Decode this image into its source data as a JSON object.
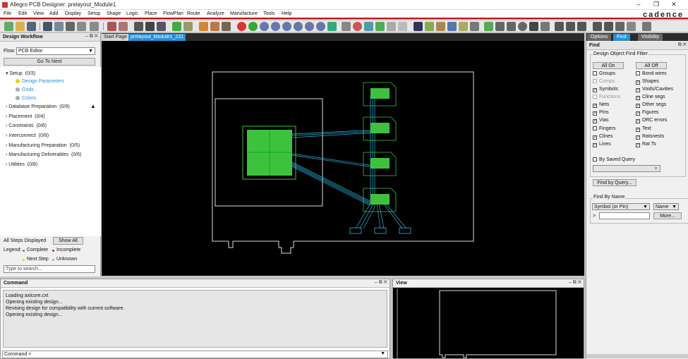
{
  "window": {
    "title": "Allegro PCB Designer: prelayout_Module1"
  },
  "brand": "cadence",
  "menu": [
    "File",
    "Edit",
    "View",
    "Add",
    "Display",
    "Setup",
    "Shape",
    "Logic",
    "Place",
    "FlowPlan",
    "Route",
    "Analyze",
    "Manufacture",
    "Tools",
    "Help"
  ],
  "workflow": {
    "title": "Design Workflow",
    "flow_label": "Flow:",
    "flow_value": "PCB Editor",
    "go_next": "Go To Next",
    "items": [
      {
        "label": "Setup",
        "count": "(0/3)"
      },
      {
        "label": "Design Parameters"
      },
      {
        "label": "Grids"
      },
      {
        "label": "Colors"
      },
      {
        "label": "Database Preparation",
        "count": "(0/9)"
      },
      {
        "label": "Placement",
        "count": "(0/4)"
      },
      {
        "label": "Constraints",
        "count": "(0/6)"
      },
      {
        "label": "Interconnect",
        "count": "(0/8)"
      },
      {
        "label": "Manufacturing Preparation",
        "count": "(0/5)"
      },
      {
        "label": "Manufacturing Deliverables",
        "count": "(0/6)"
      },
      {
        "label": "Utilities",
        "count": "(0/8)"
      }
    ],
    "all_steps": "All Steps Displayed",
    "show_all": "Show All",
    "legend_label": "Legend:",
    "legend": [
      "Complete",
      "Incomplete",
      "Next Step",
      "Unknown"
    ],
    "search_placeholder": "Type to search..."
  },
  "tabs": [
    "Start Page",
    "prelayout_Module1_231"
  ],
  "command": {
    "title": "Command",
    "lines": [
      "Loading axlcore.cxt",
      "Opening existing design...",
      "Revising design for compatibility with current software.",
      "Opening existing design..."
    ],
    "prompt": "Command >"
  },
  "view": {
    "title": "View"
  },
  "right": {
    "tabs": [
      "Options",
      "Find",
      "Visibility"
    ],
    "find_title": "Find",
    "filter_group": "Design Object Find Filter",
    "all_on": "All On",
    "all_off": "All Off",
    "left_items": [
      {
        "label": "Groups",
        "checked": false
      },
      {
        "label": "Comps",
        "checked": false,
        "disabled": true
      },
      {
        "label": "Symbols",
        "checked": true
      },
      {
        "label": "Functions",
        "checked": false,
        "disabled": true
      },
      {
        "label": "Nets",
        "checked": true
      },
      {
        "label": "Pins",
        "checked": true
      },
      {
        "label": "Vias",
        "checked": true
      },
      {
        "label": "Fingers",
        "checked": false
      },
      {
        "label": "Clines",
        "checked": true
      },
      {
        "label": "Lines",
        "checked": true
      }
    ],
    "right_items": [
      {
        "label": "Bond wires",
        "checked": false
      },
      {
        "label": "Shapes",
        "checked": true
      },
      {
        "label": "Voids/Cavities",
        "checked": true
      },
      {
        "label": "Cline segs",
        "checked": true
      },
      {
        "label": "Other segs",
        "checked": true
      },
      {
        "label": "Figures",
        "checked": true
      },
      {
        "label": "DRC errors",
        "checked": true
      },
      {
        "label": "Text",
        "checked": true
      },
      {
        "label": "Ratsnests",
        "checked": true
      },
      {
        "label": "Rat Ts",
        "checked": true
      }
    ],
    "saved_query": "By Saved Query",
    "find_by_query": "Find by Query...",
    "find_by_name_group": "Find By Name",
    "symbol_select": "Symbol (or Pin)",
    "name_select": "Name",
    "more": "More...",
    "arrow": ">"
  },
  "colors": {
    "accent": "#b11",
    "board": "#ffffff",
    "pads": "#3ec23e",
    "traces": "#29b6e0",
    "tab_active": "#2a8fd6"
  }
}
